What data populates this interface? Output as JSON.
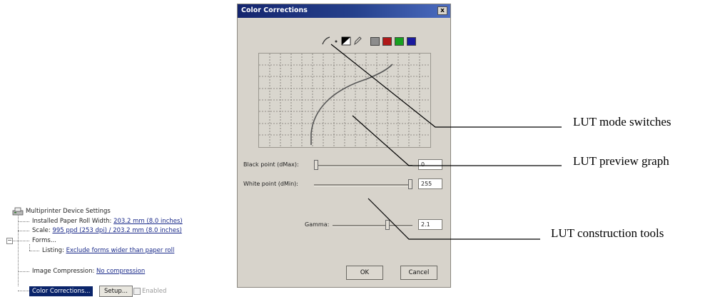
{
  "tree": {
    "root_label": "Multiprinter Device Settings",
    "items": [
      {
        "label": "Installed Paper Roll Width:",
        "value": "203.2 mm (8.0 inches)"
      },
      {
        "label": "Scale:",
        "value": "995 ppd (253 dpi) / 203.2 mm (8.0 inches)"
      },
      {
        "label": "Forms...",
        "value": ""
      },
      {
        "label": "Listing:",
        "value": "Exclude forms wider than paper roll"
      },
      {
        "label": "Image Compression:",
        "value": "No compression"
      }
    ],
    "color_corrections_label": "Color Corrections...",
    "setup_label": "Setup...",
    "enabled_label": "Enabled",
    "expander": "−"
  },
  "dialog": {
    "title": "Color Corrections",
    "close_glyph": "x",
    "mode_icons": [
      "curve-icon",
      "dot-icon",
      "black-white-icon",
      "pen-icon"
    ],
    "channel_swatches": [
      {
        "name": "gray",
        "color": "#8c8c8c"
      },
      {
        "name": "red",
        "color": "#b01818"
      },
      {
        "name": "green",
        "color": "#17a020"
      },
      {
        "name": "blue",
        "color": "#1a1a9e"
      }
    ],
    "black_point_label": "Black point (dMax):",
    "black_point_value": "0",
    "black_point_slider_fraction": 0.0,
    "white_point_label": "White point (dMin):",
    "white_point_value": "255",
    "white_point_slider_fraction": 1.0,
    "gamma_label": "Gamma:",
    "gamma_value": "2.1",
    "gamma_slider_fraction": 0.7,
    "ok_label": "OK",
    "cancel_label": "Cancel"
  },
  "annotations": {
    "mode_switches": "LUT mode switches",
    "preview_graph": "LUT preview graph",
    "construction_tools": "LUT construction tools"
  }
}
